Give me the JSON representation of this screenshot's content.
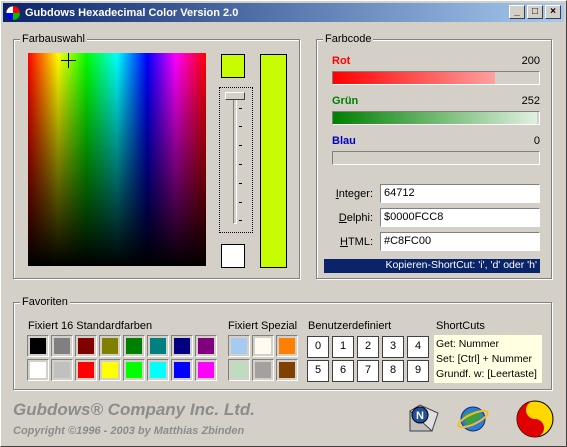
{
  "window": {
    "title": "Gubdows Hexadecimal Color Version 2.0",
    "buttons": {
      "minimize": "_",
      "maximize": "□",
      "close": "×"
    }
  },
  "farbauswahl": {
    "title": "Farbauswahl",
    "selected_color": "#C8FC00"
  },
  "farbcode": {
    "title": "Farbcode",
    "rot": {
      "label": "Rot",
      "value": "200",
      "color": "#ff0000"
    },
    "gruen": {
      "label": "Grün",
      "value": "252",
      "color": "#008000"
    },
    "blau": {
      "label": "Blau",
      "value": "0",
      "color": "#0000c0"
    },
    "integer": {
      "label_pre": "",
      "label_u": "I",
      "label_post": "nteger:",
      "value": "64712"
    },
    "delphi": {
      "label_pre": "",
      "label_u": "D",
      "label_post": "elphi:",
      "value": "$0000FCC8"
    },
    "html": {
      "label_pre": "",
      "label_u": "H",
      "label_post": "TML:",
      "value": "#C8FC00"
    },
    "shortcut_hint": "Kopieren-ShortCut: 'i', 'd' oder 'h'"
  },
  "favoriten": {
    "title": "Favoriten",
    "standard": {
      "title": "Fixiert 16 Standardfarben",
      "row1": [
        "#000000",
        "#808080",
        "#800000",
        "#808000",
        "#008000",
        "#008080",
        "#000080",
        "#800080"
      ],
      "row2": [
        "#ffffff",
        "#c0c0c0",
        "#ff0000",
        "#ffff00",
        "#00ff00",
        "#00ffff",
        "#0000ff",
        "#ff00ff"
      ]
    },
    "spezial": {
      "title": "Fixiert Spezial",
      "row1": [
        "#a6caf0",
        "#fffbf0",
        "#ff8000"
      ],
      "row2": [
        "#c0dcc0",
        "#a4a0a0",
        "#804000"
      ]
    },
    "benutzer": {
      "title": "Benutzerdefiniert",
      "row1": [
        "0",
        "1",
        "2",
        "3",
        "4"
      ],
      "row2": [
        "5",
        "6",
        "7",
        "8",
        "9"
      ]
    },
    "shortcuts": {
      "title": "ShortCuts",
      "line1": "Get: Nummer",
      "line2": "Set: [Ctrl] + Nummer",
      "line3": "Grundf. w: [Leertaste]"
    }
  },
  "footer": {
    "company": "Gubdows® Company Inc. Ltd.",
    "copyright": "Copyright ©1996 - 2003  by   Matthias Zbinden"
  }
}
